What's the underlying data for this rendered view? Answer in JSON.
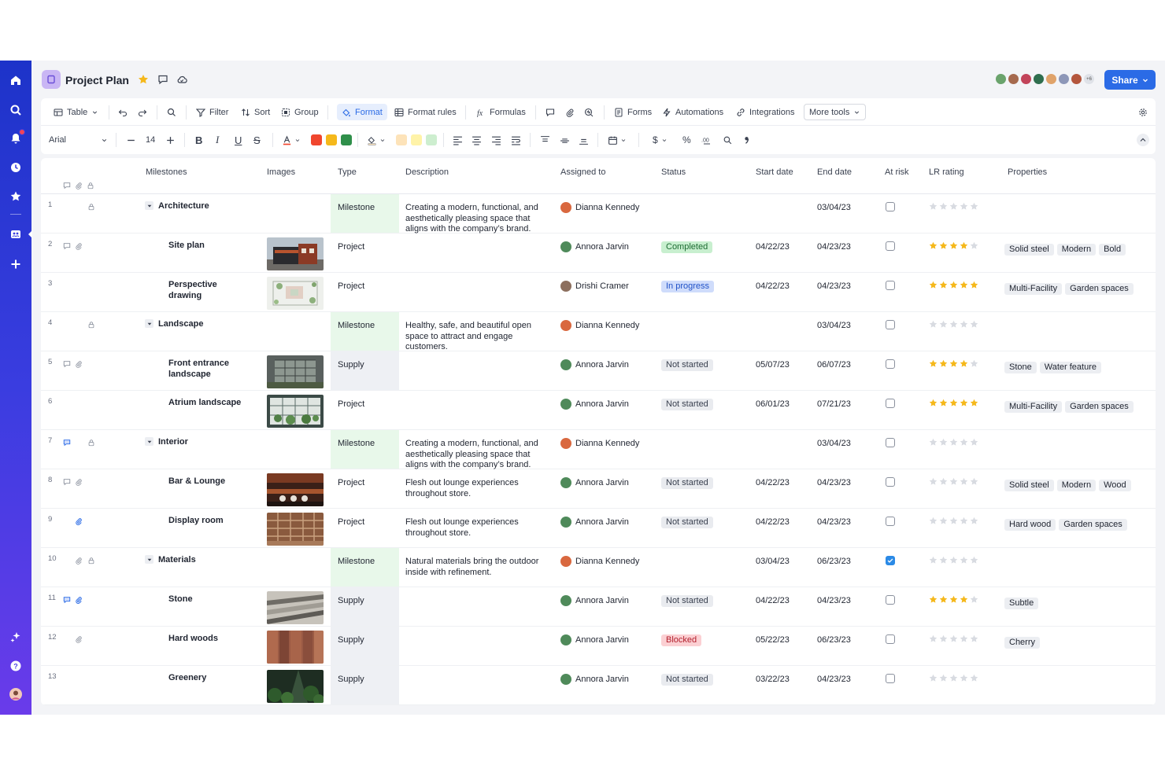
{
  "header": {
    "project_title": "Project Plan",
    "share_label": "Share",
    "avatar_overflow": "+6"
  },
  "toolbar": {
    "view_label": "Table",
    "filter_label": "Filter",
    "sort_label": "Sort",
    "group_label": "Group",
    "format_label": "Format",
    "format_rules_label": "Format rules",
    "formulas_label": "Formulas",
    "forms_label": "Forms",
    "automations_label": "Automations",
    "integrations_label": "Integrations",
    "more_tools_label": "More tools"
  },
  "formatbar": {
    "font": "Arial",
    "font_size": "14",
    "currency_symbol": "$",
    "percent_symbol": "%"
  },
  "colors": {
    "text_red": "#f0462e",
    "text_yellow": "#f5b81b",
    "text_green": "#2f8f4a",
    "fill_peach": "#fde3b9",
    "fill_yellow": "#fff3a8",
    "fill_green": "#cdeecf",
    "accent": "#2b6be6"
  },
  "columns": [
    "Milestones",
    "Images",
    "Type",
    "Description",
    "Assigned to",
    "Status",
    "Start date",
    "End date",
    "At risk",
    "LR rating",
    "Properties"
  ],
  "rows": [
    {
      "num": "1",
      "name": "Architecture",
      "level": 0,
      "type": "Milestone",
      "description": "Creating a modern, functional, and aesthetically pleasing space that aligns with the company’s brand.",
      "assigned": "Dianna Kennedy",
      "status": "",
      "start": "",
      "end": "03/04/23",
      "at_risk": false,
      "rating": 0,
      "properties": [],
      "icons": [
        "lock"
      ],
      "image": ""
    },
    {
      "num": "2",
      "name": "Site plan",
      "level": 1,
      "type": "Project",
      "description": "",
      "assigned": "Annora Jarvin",
      "status": "Completed",
      "start": "04/22/23",
      "end": "04/23/23",
      "at_risk": false,
      "rating": 4,
      "properties": [
        "Solid steel",
        "Modern",
        "Bold"
      ],
      "icons": [
        "comment",
        "clip"
      ],
      "image": "building"
    },
    {
      "num": "3",
      "name": "Perspective drawing",
      "level": 1,
      "type": "Project",
      "description": "",
      "assigned": "Drishi Cramer",
      "status": "In progress",
      "start": "04/22/23",
      "end": "04/23/23",
      "at_risk": false,
      "rating": 5,
      "properties": [
        "Multi-Facility",
        "Garden spaces"
      ],
      "icons": [],
      "image": "plan"
    },
    {
      "num": "4",
      "name": "Landscape",
      "level": 0,
      "type": "Milestone",
      "description": "Healthy, safe, and beautiful open space to attract and engage customers.",
      "assigned": "Dianna Kennedy",
      "status": "",
      "start": "",
      "end": "03/04/23",
      "at_risk": false,
      "rating": 0,
      "properties": [],
      "icons": [
        "lock"
      ],
      "image": ""
    },
    {
      "num": "5",
      "name": "Front entrance landscape",
      "level": 1,
      "type": "Supply",
      "description": "",
      "assigned": "Annora Jarvin",
      "status": "Not started",
      "start": "05/07/23",
      "end": "06/07/23",
      "at_risk": false,
      "rating": 4,
      "properties": [
        "Stone",
        "Water feature"
      ],
      "icons": [
        "comment",
        "clip"
      ],
      "image": "glass"
    },
    {
      "num": "6",
      "name": "Atrium landscape",
      "level": 1,
      "type": "Project",
      "description": "",
      "assigned": "Annora Jarvin",
      "status": "Not started",
      "start": "06/01/23",
      "end": "07/21/23",
      "at_risk": false,
      "rating": 5,
      "properties": [
        "Multi-Facility",
        "Garden spaces"
      ],
      "icons": [],
      "image": "atrium"
    },
    {
      "num": "7",
      "name": "Interior",
      "level": 0,
      "type": "Milestone",
      "description": "Creating a modern, functional, and aesthetically pleasing space that aligns with the company’s brand.",
      "assigned": "Dianna Kennedy",
      "status": "",
      "start": "",
      "end": "03/04/23",
      "at_risk": false,
      "rating": 0,
      "properties": [],
      "icons": [
        "comment-blue",
        "lock"
      ],
      "image": ""
    },
    {
      "num": "8",
      "name": "Bar & Lounge",
      "level": 1,
      "type": "Project",
      "description": "Flesh out lounge experiences throughout store.",
      "assigned": "Annora Jarvin",
      "status": "Not started",
      "start": "04/22/23",
      "end": "04/23/23",
      "at_risk": false,
      "rating": 0,
      "properties": [
        "Solid steel",
        "Modern",
        "Wood"
      ],
      "icons": [
        "comment",
        "clip"
      ],
      "image": "bar"
    },
    {
      "num": "9",
      "name": "Display room",
      "level": 1,
      "type": "Project",
      "description": "Flesh out lounge experiences throughout store.",
      "assigned": "Annora Jarvin",
      "status": "Not started",
      "start": "04/22/23",
      "end": "04/23/23",
      "at_risk": false,
      "rating": 0,
      "properties": [
        "Hard wood",
        "Garden spaces"
      ],
      "icons": [
        "clip-blue"
      ],
      "image": "shelves"
    },
    {
      "num": "10",
      "name": "Materials",
      "level": 0,
      "type": "Milestone",
      "description": "Natural materials bring the outdoor inside with refinement.",
      "assigned": "Dianna Kennedy",
      "status": "",
      "start": "03/04/23",
      "end": "06/23/23",
      "at_risk": true,
      "rating": 0,
      "properties": [],
      "icons": [
        "clip",
        "lock"
      ],
      "image": ""
    },
    {
      "num": "11",
      "name": "Stone",
      "level": 1,
      "type": "Supply",
      "description": "",
      "assigned": "Annora Jarvin",
      "status": "Not started",
      "start": "04/22/23",
      "end": "04/23/23",
      "at_risk": false,
      "rating": 4,
      "properties": [
        "Subtle"
      ],
      "icons": [
        "comment-blue",
        "clip-blue"
      ],
      "image": "stone"
    },
    {
      "num": "12",
      "name": "Hard woods",
      "level": 1,
      "type": "Supply",
      "description": "",
      "assigned": "Annora Jarvin",
      "status": "Blocked",
      "start": "05/22/23",
      "end": "06/23/23",
      "at_risk": false,
      "rating": 0,
      "properties": [
        "Cherry"
      ],
      "icons": [
        "clip"
      ],
      "image": "wood"
    },
    {
      "num": "13",
      "name": "Greenery",
      "level": 1,
      "type": "Supply",
      "description": "",
      "assigned": "Annora Jarvin",
      "status": "Not started",
      "start": "03/22/23",
      "end": "04/23/23",
      "at_risk": false,
      "rating": 0,
      "properties": [],
      "icons": [],
      "image": "greenery"
    }
  ]
}
